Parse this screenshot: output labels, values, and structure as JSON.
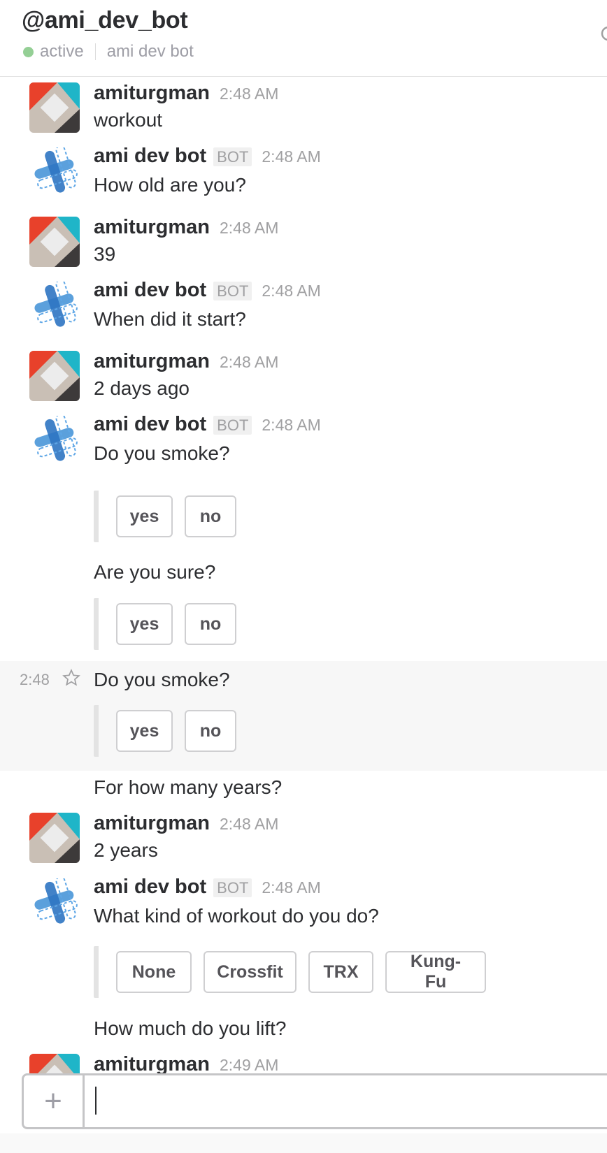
{
  "header": {
    "title": "@ami_dev_bot",
    "status": "active",
    "real_name": "ami dev bot"
  },
  "labels": {
    "bot_badge": "BOT"
  },
  "messages": {
    "m1": {
      "author": "amiturgman",
      "time": "2:48 AM",
      "text": "workout"
    },
    "m2": {
      "author": "ami dev bot",
      "time": "2:48 AM",
      "text": "How old are you?"
    },
    "m3": {
      "author": "amiturgman",
      "time": "2:48 AM",
      "text": "39"
    },
    "m4": {
      "author": "ami dev bot",
      "time": "2:48 AM",
      "text": "When did it start?"
    },
    "m5": {
      "author": "amiturgman",
      "time": "2:48 AM",
      "text": "2 days ago"
    },
    "m6": {
      "author": "ami dev bot",
      "time": "2:48 AM",
      "text": "Do you smoke?"
    },
    "m6b": {
      "text": "Are you sure?"
    },
    "m6c": {
      "time": "2:48",
      "text": "Do you smoke?"
    },
    "m6d": {
      "text": "For how many years?"
    },
    "m7": {
      "author": "amiturgman",
      "time": "2:48 AM",
      "text": "2 years"
    },
    "m8": {
      "author": "ami dev bot",
      "time": "2:48 AM",
      "text": "What kind of workout do you do?"
    },
    "m8b": {
      "text": "How much do you lift?"
    },
    "m9": {
      "author": "amiturgman",
      "time": "2:49 AM"
    }
  },
  "buttons": {
    "yes": "yes",
    "no": "no",
    "workout_options": [
      "None",
      "Crossfit",
      "TRX",
      "Kung-Fu"
    ]
  },
  "composer": {
    "plus": "+"
  },
  "colors": {
    "status_active": "#94cf95",
    "avatar_red": "#e8412b",
    "avatar_cyan": "#1fb5c8",
    "bot_blue": "#3e8fd6"
  },
  "icons": {
    "user_avatar": "avatar-icon",
    "bot_avatar": "bot-avatar-icon",
    "star": "star-icon",
    "plus": "plus-icon",
    "header_settings": "gear-icon"
  }
}
